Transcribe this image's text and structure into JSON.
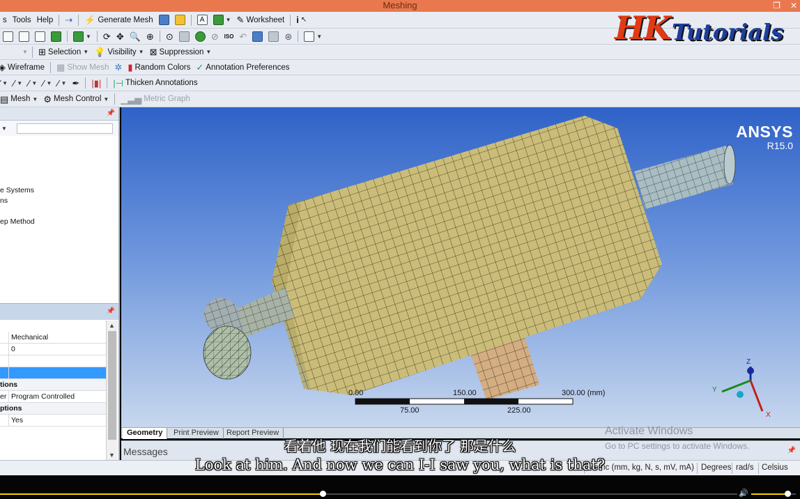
{
  "window": {
    "title": "Meshing"
  },
  "menu": {
    "tools": "Tools",
    "help": "Help"
  },
  "toolbar1": {
    "generate_mesh": "Generate Mesh",
    "worksheet": "Worksheet"
  },
  "toolbar3": {
    "selection": "Selection",
    "visibility": "Visibility",
    "suppression": "Suppression"
  },
  "toolbar4": {
    "wireframe": "Wireframe",
    "show_mesh": "Show Mesh",
    "random_colors": "Random Colors",
    "annotation_preferences": "Annotation Preferences"
  },
  "toolbar5": {
    "thicken_annotations": "Thicken Annotations"
  },
  "toolbar6": {
    "mesh": "Mesh",
    "mesh_control": "Mesh Control",
    "metric_graph": "Metric Graph"
  },
  "logo": {
    "hk": "HK",
    "tutorials": "Tutorials"
  },
  "tree": {
    "items": [
      "e Systems",
      "ns",
      "",
      "ep Method"
    ]
  },
  "details": {
    "rows": [
      {
        "key": "",
        "value": "Mechanical",
        "type": "normal"
      },
      {
        "key": "",
        "value": "0",
        "type": "normal"
      },
      {
        "key": "",
        "value": "",
        "type": "blank"
      },
      {
        "key": "",
        "value": "",
        "type": "selected"
      },
      {
        "key": "tions",
        "value": "",
        "type": "group"
      },
      {
        "key": "er",
        "value": "Program Controlled",
        "type": "normal"
      },
      {
        "key": "ptions",
        "value": "",
        "type": "group"
      },
      {
        "key": "",
        "value": "Yes",
        "type": "normal"
      }
    ]
  },
  "viewport": {
    "brand": "ANSYS",
    "version": "R15.0",
    "scale": {
      "labels_top": [
        "0.00",
        "150.00",
        "300.00 (mm)"
      ],
      "labels_bottom": [
        "75.00",
        "225.00"
      ]
    },
    "triad": {
      "x": "X",
      "y": "Y",
      "z": "Z"
    },
    "colors": {
      "body": "#cfc07a",
      "pipe": "#9fb4b9",
      "bracket": "#d4ad82",
      "mesh_line": "#2d2a18"
    }
  },
  "tabs": [
    "Geometry",
    "Print Preview",
    "Report Preview"
  ],
  "messages_label": "Messages",
  "watermark": {
    "line1": "Activate Windows",
    "line2": "Go to PC settings to activate Windows."
  },
  "status": {
    "units": "Metric (mm, kg, N, s, mV, mA)",
    "angle": "Degrees",
    "rate": "rad/s",
    "temp": "Celsius"
  },
  "subtitles": {
    "cn": "看着他 现在我们能看到你了 那是什么",
    "en": "Look at him. And now we can I-I saw you, what is that?"
  },
  "player": {
    "progress": 0.438,
    "volume": 0.82,
    "accent": "#f5cf00"
  }
}
